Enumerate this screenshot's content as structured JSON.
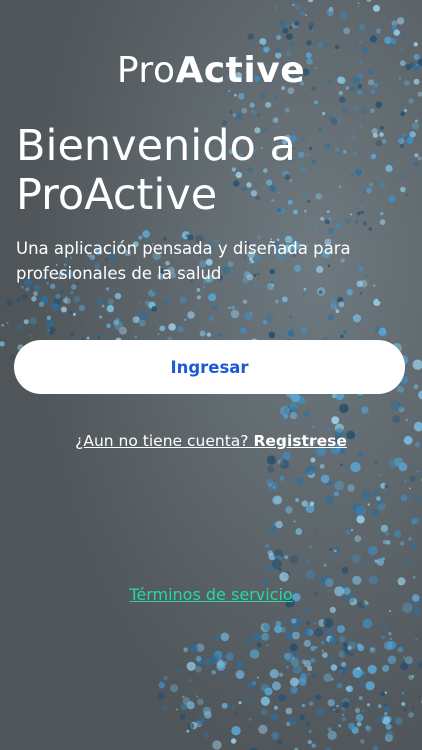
{
  "brand": {
    "logo_light": "Pro",
    "logo_bold": "Active"
  },
  "welcome": {
    "title": "Bienvenido a ProActive",
    "subtitle": "Una aplicación pensada y diseñada para profesionales de la salud"
  },
  "actions": {
    "login_label": "Ingresar",
    "register_question": "¿Aun no tiene cuenta?",
    "register_link": "Registrese",
    "terms_label": "Términos de servicio"
  },
  "colors": {
    "login_text": "#1d5bd6",
    "terms_link": "#27d7a3",
    "particles": "#4a9fd0"
  }
}
